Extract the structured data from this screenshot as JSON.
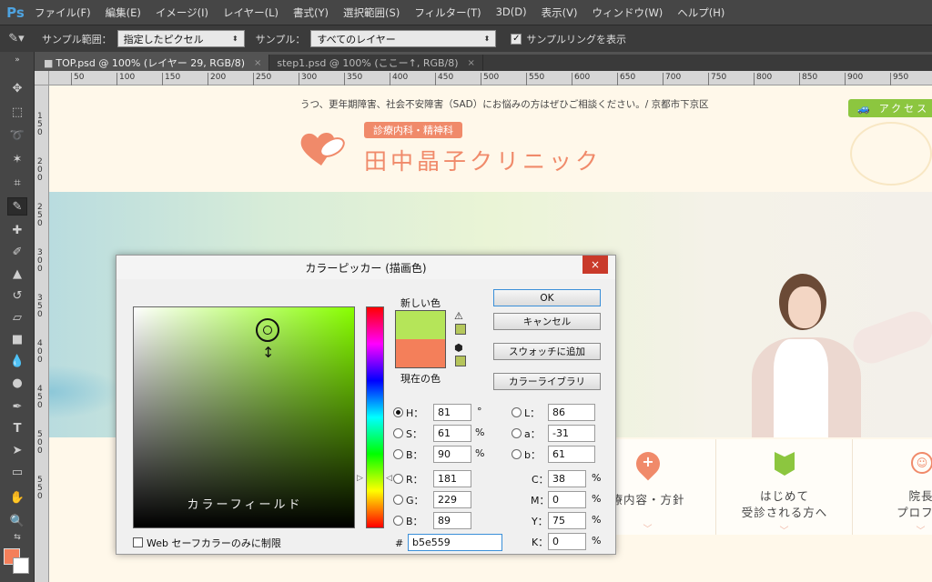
{
  "app": {
    "logo": "Ps",
    "menu": [
      "ファイル(F)",
      "編集(E)",
      "イメージ(I)",
      "レイヤー(L)",
      "書式(Y)",
      "選択範囲(S)",
      "フィルター(T)",
      "3D(D)",
      "表示(V)",
      "ウィンドウ(W)",
      "ヘルプ(H)"
    ]
  },
  "options": {
    "sample_size_label": "サンプル範囲：",
    "sample_size_value": "指定したピクセル",
    "sample_label": "サンプル：",
    "sample_value": "すべてのレイヤー",
    "show_ring_label": "サンプルリングを表示",
    "show_ring_checked": true
  },
  "tabs": [
    {
      "label": "TOP.psd @ 100% (レイヤー 29, RGB/8)",
      "close": "×",
      "active": true
    },
    {
      "label": "step1.psd @ 100% (ここー↑, RGB/8)",
      "close": "×",
      "active": false
    }
  ],
  "ruler_top": [
    "50",
    "100",
    "150",
    "200",
    "250",
    "300",
    "350",
    "400",
    "450",
    "500",
    "550",
    "600",
    "650",
    "700",
    "750",
    "800",
    "850",
    "900",
    "950"
  ],
  "ruler_left": [
    "1 5 0",
    "2 0 0",
    "2 5 0",
    "3 0 0",
    "3 5 0",
    "4 0 0",
    "4 5 0",
    "5 0 0",
    "5 5 0"
  ],
  "website": {
    "top_message": "うつ、更年期障害、社会不安障害（SAD）にお悩みの方はぜひご相談ください。/ 京都市下京区",
    "access_button": "アクセス",
    "department_badge": "診療内科・精神科",
    "clinic_name": "田中晶子クリニック",
    "nav": [
      {
        "label_line1": "療内容・方針",
        "label_line2": ""
      },
      {
        "label_line1": "はじめて",
        "label_line2": "受診される方へ"
      },
      {
        "label_line1": "院長",
        "label_line2": "プロフィ"
      }
    ]
  },
  "dialog": {
    "title": "カラーピッカー (描画色)",
    "close": "×",
    "ok": "OK",
    "cancel": "キャンセル",
    "add_swatch": "スウォッチに追加",
    "color_library": "カラーライブラリ",
    "new_label": "新しい色",
    "current_label": "現在の色",
    "new_color": "#b5e559",
    "current_color": "#f47f5a",
    "gamut_warning_color": "#b5c85c",
    "web_warning_color": "#b5c45a",
    "color_field_label": "カラーフィールド",
    "web_only_label": "Web セーフカラーのみに制限",
    "web_only_checked": false,
    "hsb": {
      "h": "81",
      "s": "61",
      "b": "90",
      "h_unit": "°",
      "s_unit": "%",
      "b_unit": "%"
    },
    "rgb": {
      "r": "181",
      "g": "229",
      "b": "89"
    },
    "lab": {
      "l": "86",
      "a": "-31",
      "b": "61"
    },
    "cmyk": {
      "c": "38",
      "m": "0",
      "y": "75",
      "k": "0",
      "unit": "%"
    },
    "hex_label": "#",
    "hex": "b5e559",
    "labels": {
      "h": "H：",
      "s": "S：",
      "b": "B：",
      "r": "R：",
      "g": "G：",
      "bb": "B：",
      "l": "L：",
      "a": "a：",
      "lb": "b：",
      "c": "C：",
      "m": "M：",
      "y": "Y：",
      "k": "K："
    },
    "selected_mode": "H"
  },
  "colors": {
    "foreground_swatch": "#f47f5a",
    "accent_green": "#8cc63f",
    "salmon": "#f08a6a"
  }
}
